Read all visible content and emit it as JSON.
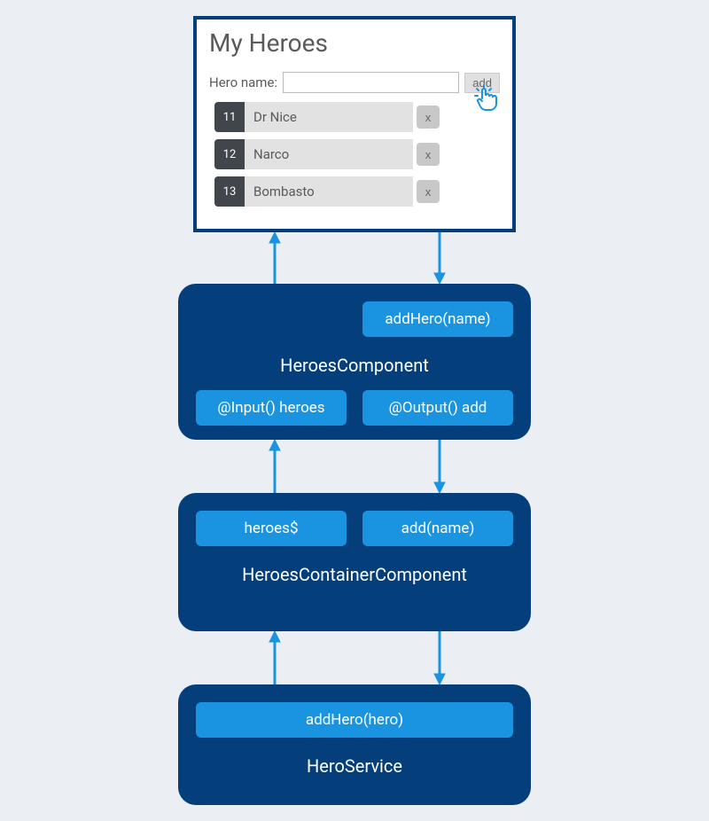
{
  "ui_panel": {
    "title": "My Heroes",
    "form": {
      "label": "Hero name:",
      "input_value": "",
      "add_button": "add"
    },
    "heroes": [
      {
        "id": "11",
        "name": "Dr Nice"
      },
      {
        "id": "12",
        "name": "Narco"
      },
      {
        "id": "13",
        "name": "Bombasto"
      }
    ],
    "delete_label": "x"
  },
  "heroes_component": {
    "title": "HeroesComponent",
    "method": "addHero(name)",
    "input_decorator": "@Input() heroes",
    "output_decorator": "@Output() add"
  },
  "container_component": {
    "title": "HeroesContainerComponent",
    "observable": "heroes$",
    "method": "add(name)"
  },
  "hero_service": {
    "title": "HeroService",
    "method": "addHero(hero)"
  }
}
